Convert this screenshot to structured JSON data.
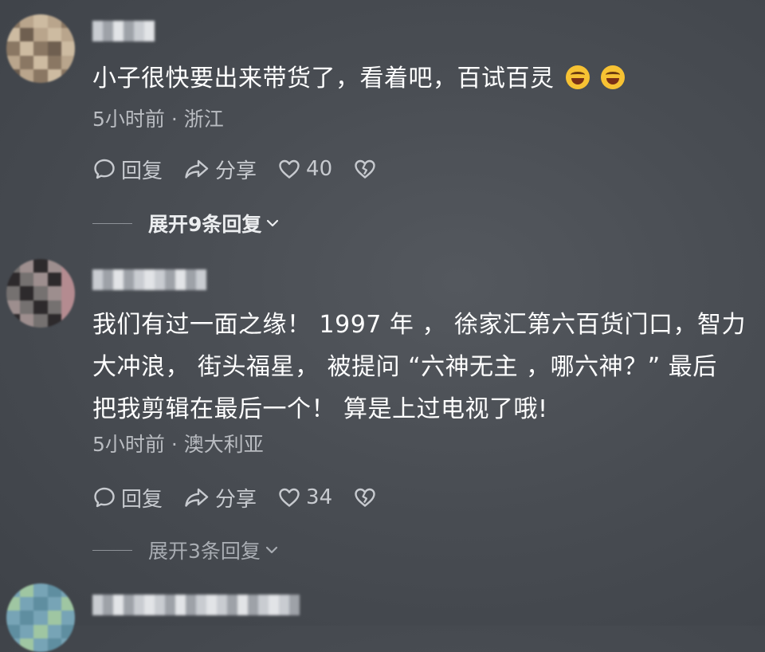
{
  "comments": [
    {
      "text": "小子很快要出来带货了，看着吧，百试百灵",
      "emoji": "laughing-crying-emoji",
      "meta": "5小时前 · 浙江",
      "reply_label": "回复",
      "share_label": "分享",
      "like_count": "40",
      "expand_label": "展开9条回复"
    },
    {
      "text": "我们有过一面之缘！ 1997 年 ， 徐家汇第六百货门口，智力\n大冲浪， 街头福星， 被提问 “六神无主 ，哪六神？” 最后\n把我剪辑在最后一个！ 算是上过电视了哦!",
      "meta": "5小时前 · 澳大利亚",
      "reply_label": "回复",
      "share_label": "分享",
      "like_count": "34",
      "expand_label": "展开3条回复"
    }
  ],
  "colors": {
    "background": "#4b4f55",
    "text_primary": "#ffffff",
    "text_secondary": "#b9bcc1",
    "emoji": "#f7c233"
  },
  "icons": [
    "reply-bubble-icon",
    "share-arrow-icon",
    "heart-icon",
    "broken-heart-icon",
    "chevron-down-icon"
  ]
}
